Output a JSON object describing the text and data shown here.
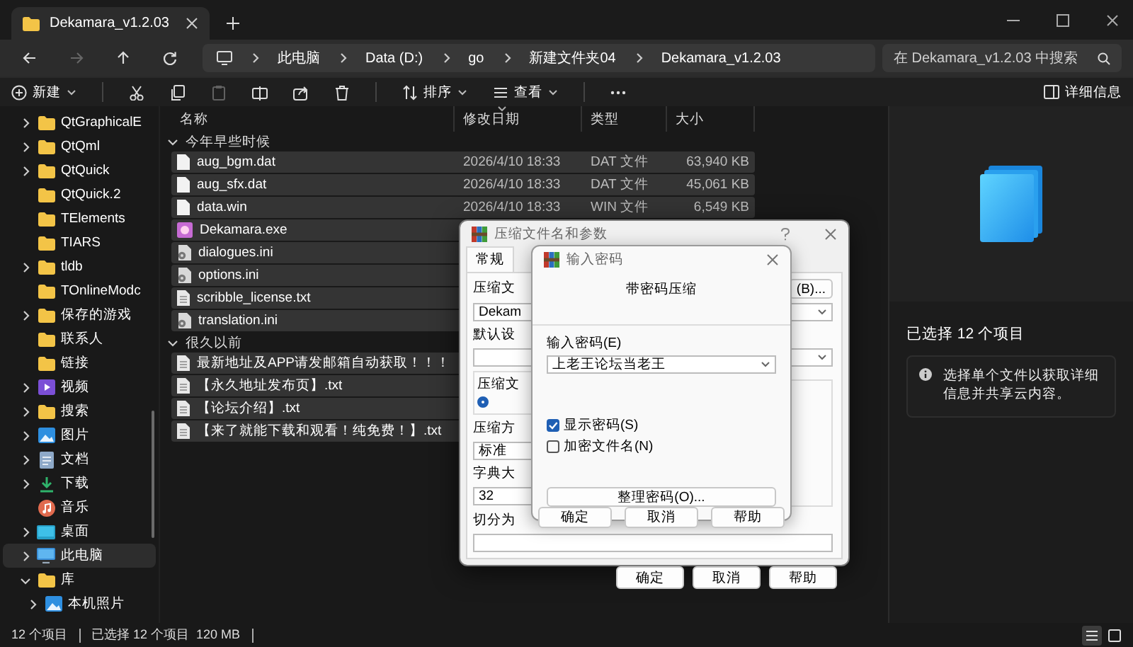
{
  "window": {
    "tab_title": "Dekamara_v1.2.03"
  },
  "nav_buttons": [
    {
      "kind": "back",
      "disabled": false
    },
    {
      "kind": "forward",
      "disabled": true
    },
    {
      "kind": "up",
      "disabled": false
    },
    {
      "kind": "refresh",
      "disabled": false
    }
  ],
  "breadcrumb": [
    "此电脑",
    "Data (D:)",
    "go",
    "新建文件夹04",
    "Dekamara_v1.2.03"
  ],
  "search": {
    "placeholder": "在 Dekamara_v1.2.03 中搜索"
  },
  "toolbar": {
    "items": [
      {
        "kind": "new",
        "label": "新建",
        "disabled": false
      },
      {
        "kind": "cut",
        "disabled": false
      },
      {
        "kind": "copy",
        "disabled": false
      },
      {
        "kind": "paste",
        "disabled": true
      },
      {
        "kind": "rename",
        "disabled": false
      },
      {
        "kind": "share",
        "disabled": false
      },
      {
        "kind": "delete",
        "disabled": false
      },
      {
        "kind": "sort",
        "label": "排序",
        "disabled": false
      },
      {
        "kind": "view",
        "label": "查看",
        "disabled": false
      },
      {
        "kind": "more",
        "disabled": false
      }
    ],
    "details_button": "详细信息"
  },
  "sidebar": {
    "items": [
      {
        "label": "QtGraphicalE",
        "kind": "folder",
        "expanded": false,
        "selected": false
      },
      {
        "label": "QtQml",
        "kind": "folder",
        "expanded": false,
        "selected": false
      },
      {
        "label": "QtQuick",
        "kind": "folder",
        "expanded": false,
        "selected": false
      },
      {
        "label": "QtQuick.2",
        "kind": "folder",
        "selected": false
      },
      {
        "label": "TElements",
        "kind": "folder",
        "selected": false
      },
      {
        "label": "TIARS",
        "kind": "folder",
        "selected": false
      },
      {
        "label": "tldb",
        "kind": "folder",
        "expanded": false,
        "selected": false
      },
      {
        "label": "TOnlineModc",
        "kind": "folder",
        "selected": false
      },
      {
        "label": "保存的游戏",
        "kind": "folder",
        "expanded": false,
        "selected": false
      },
      {
        "label": "联系人",
        "kind": "folder",
        "selected": false
      },
      {
        "label": "链接",
        "kind": "folder",
        "selected": false
      },
      {
        "label": "视频",
        "kind": "video",
        "expanded": false,
        "selected": false
      },
      {
        "label": "搜索",
        "kind": "folder",
        "expanded": false,
        "selected": false
      },
      {
        "label": "图片",
        "kind": "pictures",
        "expanded": false,
        "selected": false
      },
      {
        "label": "文档",
        "kind": "documents",
        "expanded": false,
        "selected": false
      },
      {
        "label": "下载",
        "kind": "downloads",
        "expanded": false,
        "selected": false
      },
      {
        "label": "音乐",
        "kind": "music",
        "selected": false
      },
      {
        "label": "桌面",
        "kind": "desktop",
        "expanded": false,
        "selected": false
      },
      {
        "label": "此电脑",
        "kind": "pc",
        "expanded": false,
        "selected": true
      },
      {
        "label": "库",
        "kind": "folder",
        "expanded": true,
        "selected": false,
        "children": [
          {
            "label": "本机照片",
            "kind": "pictures",
            "expanded": false,
            "selected": false
          }
        ]
      }
    ]
  },
  "file_list": {
    "columns": [
      {
        "label": "名称",
        "sorted": false
      },
      {
        "label": "修改日期",
        "sorted": true
      },
      {
        "label": "类型",
        "sorted": false
      },
      {
        "label": "大小",
        "sorted": false
      }
    ],
    "groups": [
      {
        "label": "今年早些时候",
        "expanded": true,
        "files": [
          {
            "name": "aug_bgm.dat",
            "kind": "file",
            "date": "2026/4/10 18:33",
            "type": "DAT 文件",
            "size": "63,940 KB",
            "selected": true
          },
          {
            "name": "aug_sfx.dat",
            "kind": "file",
            "date": "2026/4/10 18:33",
            "type": "DAT 文件",
            "size": "45,061 KB",
            "selected": true
          },
          {
            "name": "data.win",
            "kind": "file",
            "date": "2026/4/10 18:33",
            "type": "WIN 文件",
            "size": "6,549 KB",
            "selected": true
          },
          {
            "name": "Dekamara.exe",
            "kind": "app",
            "selected": true
          },
          {
            "name": "dialogues.ini",
            "kind": "settings",
            "selected": true
          },
          {
            "name": "options.ini",
            "kind": "settings",
            "selected": true
          },
          {
            "name": "scribble_license.txt",
            "kind": "text",
            "selected": true
          },
          {
            "name": "translation.ini",
            "kind": "settings",
            "selected": true
          }
        ]
      },
      {
        "label": "很久以前",
        "expanded": true,
        "files": [
          {
            "name": "最新地址及APP请发邮箱自动获取！！！",
            "kind": "text",
            "selected": true
          },
          {
            "name": "【永久地址发布页】.txt",
            "kind": "text",
            "selected": true
          },
          {
            "name": "【论坛介绍】.txt",
            "kind": "text",
            "selected": true
          },
          {
            "name": "【来了就能下载和观看！纯免费！】.txt",
            "kind": "text",
            "selected": true
          }
        ]
      }
    ]
  },
  "details": {
    "heading": "已选择 12 个项目",
    "info": "选择单个文件以获取详细信息并共享云内容。"
  },
  "status_bar": {
    "item_count": "12 个项目",
    "selection": "已选择 12 个项目  120 MB",
    "view_buttons": [
      {
        "kind": "details",
        "selected": true
      },
      {
        "kind": "tiles",
        "selected": false
      }
    ]
  },
  "archive_dialog": {
    "title": "压缩文件名和参数",
    "tabs": [
      {
        "label": "常规",
        "selected": true
      }
    ],
    "archive_label": "压缩文",
    "browse_button": "(B)...",
    "archive_name": "Dekam",
    "profile_label": "默认设",
    "format_group": "压缩文",
    "format_radio_checked": true,
    "method_label": "压缩方",
    "method_value": "标准",
    "dict_label": "字典大",
    "dict_value": "32",
    "split_label": "切分为",
    "buttons": [
      "确定",
      "取消",
      "帮助"
    ]
  },
  "password_dialog": {
    "title": "输入密码",
    "heading": "带密码压缩",
    "password_label": "输入密码(E)",
    "password": "上老王论坛当老王",
    "options": [
      {
        "label": "显示密码(S)",
        "checked": true
      },
      {
        "label": "加密文件名(N)",
        "checked": false
      }
    ],
    "organize_button": "整理密码(O)...",
    "buttons": [
      "确定",
      "取消",
      "帮助"
    ]
  }
}
